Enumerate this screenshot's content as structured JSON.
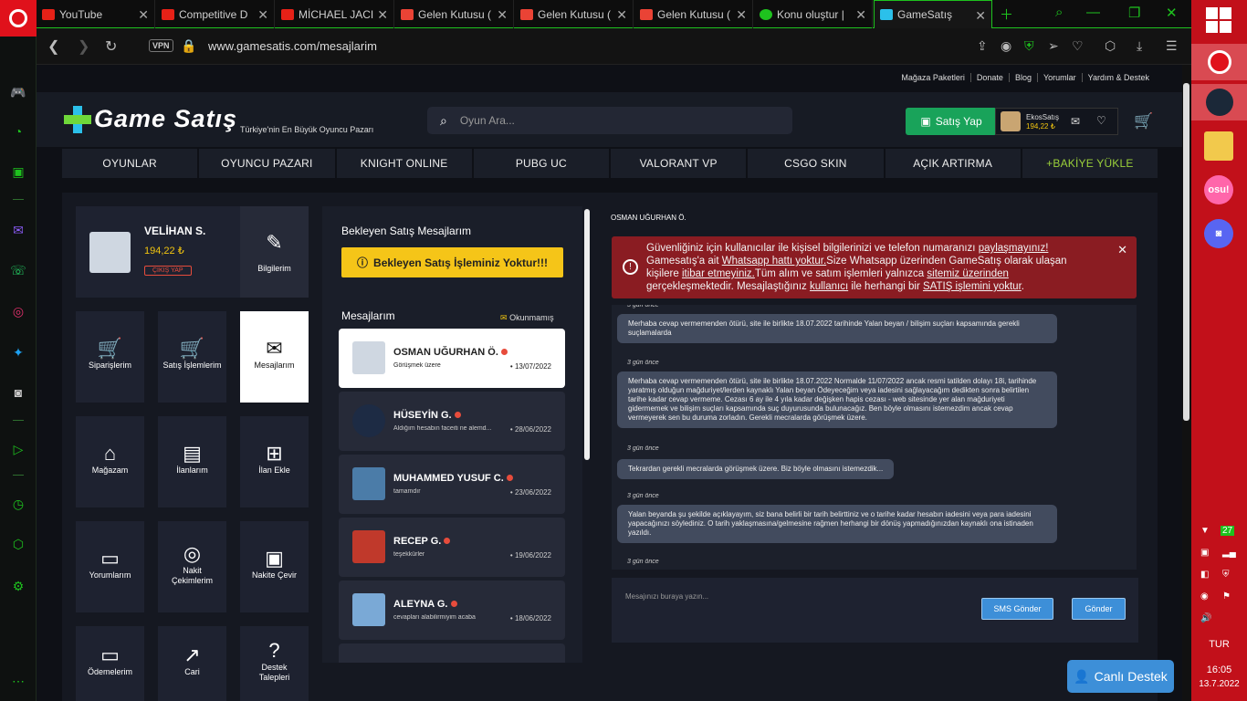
{
  "tabs": [
    {
      "label": "YouTube",
      "color": "#e62117"
    },
    {
      "label": "Competitive D",
      "color": "#e62117"
    },
    {
      "label": "MİCHAEL JACI",
      "color": "#e62117"
    },
    {
      "label": "Gelen Kutusu (",
      "color": "#ea4335"
    },
    {
      "label": "Gelen Kutusu (",
      "color": "#ea4335"
    },
    {
      "label": "Gelen Kutusu (",
      "color": "#ea4335"
    },
    {
      "label": "Konu oluştur |",
      "color": "#1ec21e"
    },
    {
      "label": "GameSatış",
      "color": "#2bc0ea"
    }
  ],
  "address": {
    "vpn": "VPN",
    "url": "www.gamesatis.com/mesajlarim"
  },
  "toplinks": [
    "Mağaza Paketleri",
    "Donate",
    "Blog",
    "Yorumlar",
    "Yardım & Destek"
  ],
  "header": {
    "brand": "Game Satış",
    "tagline": "Türkiye'nin En Büyük Oyuncu Pazarı",
    "search_placeholder": "Oyun Ara...",
    "sell_label": "Satış Yap",
    "user_name": "EkosSatış",
    "user_balance": "194,22 ₺"
  },
  "categories": [
    "OYUNLAR",
    "OYUNCU PAZARI",
    "KNIGHT ONLINE",
    "PUBG UC",
    "VALORANT VP",
    "CSGO SKIN",
    "AÇIK ARTIRMA",
    "+BAKİYE YÜKLE"
  ],
  "profile": {
    "name": "VELİHAN S.",
    "balance": "194,22 ₺",
    "logout": "ÇIKIŞ YAP",
    "info": "Bilgilerim"
  },
  "tiles": [
    {
      "label": "Siparişlerim",
      "icon": "cart-icon"
    },
    {
      "label": "Satış İşlemlerim",
      "icon": "cart-icon"
    },
    {
      "label": "Mesajlarım",
      "icon": "mail-icon"
    },
    {
      "label": "Mağazam",
      "icon": "store-icon"
    },
    {
      "label": "İlanlarım",
      "icon": "clipboard-icon"
    },
    {
      "label": "İlan Ekle",
      "icon": "clipboard-plus-icon"
    },
    {
      "label": "Yorumlarım",
      "icon": "comment-icon"
    },
    {
      "label": "Nakit Çekimlerim",
      "icon": "coins-icon"
    },
    {
      "label": "Nakite Çevir",
      "icon": "wallet-icon"
    },
    {
      "label": "Ödemelerim",
      "icon": "card-icon"
    },
    {
      "label": "Cari",
      "icon": "chart-icon"
    },
    {
      "label": "Destek Talepleri",
      "icon": "question-icon"
    }
  ],
  "pending": {
    "title": "Bekleyen Satış Mesajlarım",
    "banner": "Bekleyen Satış İşleminiz Yoktur!!!"
  },
  "messages": {
    "title": "Mesajlarım",
    "unread_label": "Okunmamış",
    "items": [
      {
        "name": "OSMAN UĞURHAN Ö.",
        "snippet": "Görüşmek üzere",
        "date": "13/07/2022",
        "selected": true
      },
      {
        "name": "HÜSEYİN G.",
        "snippet": "Aldığım hesabın faceiti ne alemd...",
        "date": "28/06/2022",
        "selected": false
      },
      {
        "name": "MUHAMMED YUSUF C.",
        "snippet": "tamamdır",
        "date": "23/06/2022",
        "selected": false
      },
      {
        "name": "RECEP G.",
        "snippet": "teşekkürler",
        "date": "19/06/2022",
        "selected": false
      },
      {
        "name": "ALEYNA G.",
        "snippet": "cevapları alabilirmiyim acaba",
        "date": "18/06/2022",
        "selected": false
      }
    ]
  },
  "chat": {
    "title": "OSMAN UĞURHAN Ö.",
    "alert": {
      "l1a": "Güvenliğiniz için kullanıcılar ile kişisel bilgilerinizi ve telefon numaranızı ",
      "l1b": "paylaşmayınız!",
      "l2a": "Gamesatış'a ait ",
      "l2b": "Whatsapp hattı yoktur.",
      "l2c": "Size Whatsapp üzerinden GameSatış olarak ulaşan",
      "l3a": "kişilere ",
      "l3b": "itibar etmeyiniz.",
      "l3c": "Tüm alım ve satım işlemleri yalnızca ",
      "l3d": "sitemiz üzerinden",
      "l4a": "gerçekleşmektedir. Mesajlaştığınız ",
      "l4b": "kullanıcı",
      "l4c": " ile herhangi bir ",
      "l4d": "SATIŞ işlemini yoktur",
      "l4e": "."
    },
    "time_label": "3 gün önce",
    "bubbles": [
      "Merhaba cevap vermemenden ötürü, site ile birlikte 18.07.2022 tarihinde Yalan beyan / bilişim suçları kapsamında gerekli suçlamalarda",
      "Merhaba cevap vermemenden ötürü, site ile birlikte 18.07.2022 Normalde 11/07/2022 ancak resmi tatilden dolayı 18i, tarihinde yaratmış olduğun mağduriyet/lerden kaynaklı Yalan beyan Ödeyeceğim veya iadesini sağlayacağım dedikten sonra belirtilen tarihe kadar cevap vermeme. Cezası 6 ay ile 4 yıla kadar değişken hapis cezası - web sitesinde yer alan mağduriyeti gidermemek ve bilişim suçları kapsamında suç duyurusunda bulunacağız. Ben böyle olmasını istemezdim ancak cevap vermeyerek sen bu duruma zorladın. Gerekli mecralarda görüşmek üzere.",
      "Tekrardan gerekli mecralarda görüşmek üzere. Biz böyle olmasını istemezdik...",
      "Yalan beyanda şu şekilde açıklayayım, siz bana belirli bir tarih belirttiniz ve o tarihe kadar hesabın iadesini veya para iadesini yapacağınızı söylediniz. O tarih yaklaşmasına/gelmesine rağmen herhangi bir dönüş yapmadığınızdan kaynaklı ona istinaden yazıldı."
    ],
    "compose_placeholder": "Mesajınızı buraya yazın...",
    "sms_button": "SMS Gönder",
    "send_button": "Gönder"
  },
  "live_support": "Canlı Destek",
  "taskbar": {
    "lang": "TUR",
    "time": "16:05",
    "date": "13.7.2022",
    "badge": "27",
    "osu": "osu!"
  }
}
